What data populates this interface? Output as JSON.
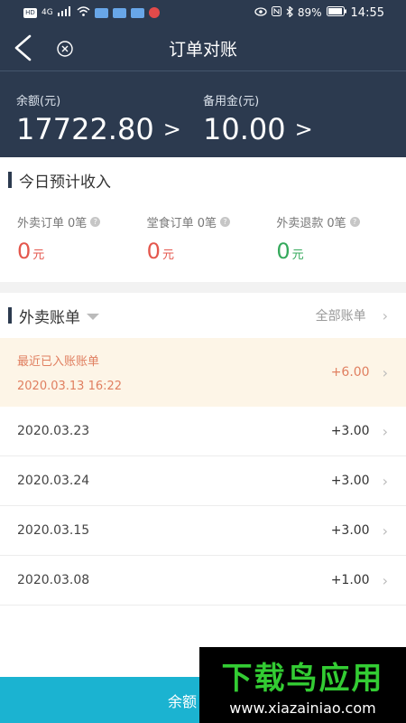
{
  "status": {
    "left_icons": [
      "HD",
      "4G",
      "signal-icon",
      "wifi-icon"
    ],
    "battery": "89%",
    "time": "14:55"
  },
  "header": {
    "title": "订单对账"
  },
  "balances": {
    "balance_label": "余额(元)",
    "balance_value": "17722.80",
    "reserve_label": "备用金(元)",
    "reserve_value": "10.00",
    "arrow": ">"
  },
  "today": {
    "title": "今日预计收入",
    "stats": [
      {
        "label": "外卖订单",
        "count": "0笔",
        "value": "0",
        "unit": "元",
        "color": "#e4574d"
      },
      {
        "label": "堂食订单",
        "count": "0笔",
        "value": "0",
        "unit": "元",
        "color": "#e4574d"
      },
      {
        "label": "外卖退款",
        "count": "0笔",
        "value": "0",
        "unit": "元",
        "color": "#35a95c"
      }
    ]
  },
  "bills": {
    "title": "外卖账单",
    "all_label": "全部账单",
    "recent": {
      "label": "最近已入账账单",
      "time": "2020.03.13 16:22",
      "amount": "+6.00"
    },
    "rows": [
      {
        "date": "2020.03.23",
        "amount": "+3.00"
      },
      {
        "date": "2020.03.24",
        "amount": "+3.00"
      },
      {
        "date": "2020.03.15",
        "amount": "+3.00"
      },
      {
        "date": "2020.03.08",
        "amount": "+1.00"
      }
    ]
  },
  "bottom": {
    "label": "余额"
  },
  "watermark": {
    "big": "下载鸟应用",
    "small": "www.xiazainiao.com"
  }
}
